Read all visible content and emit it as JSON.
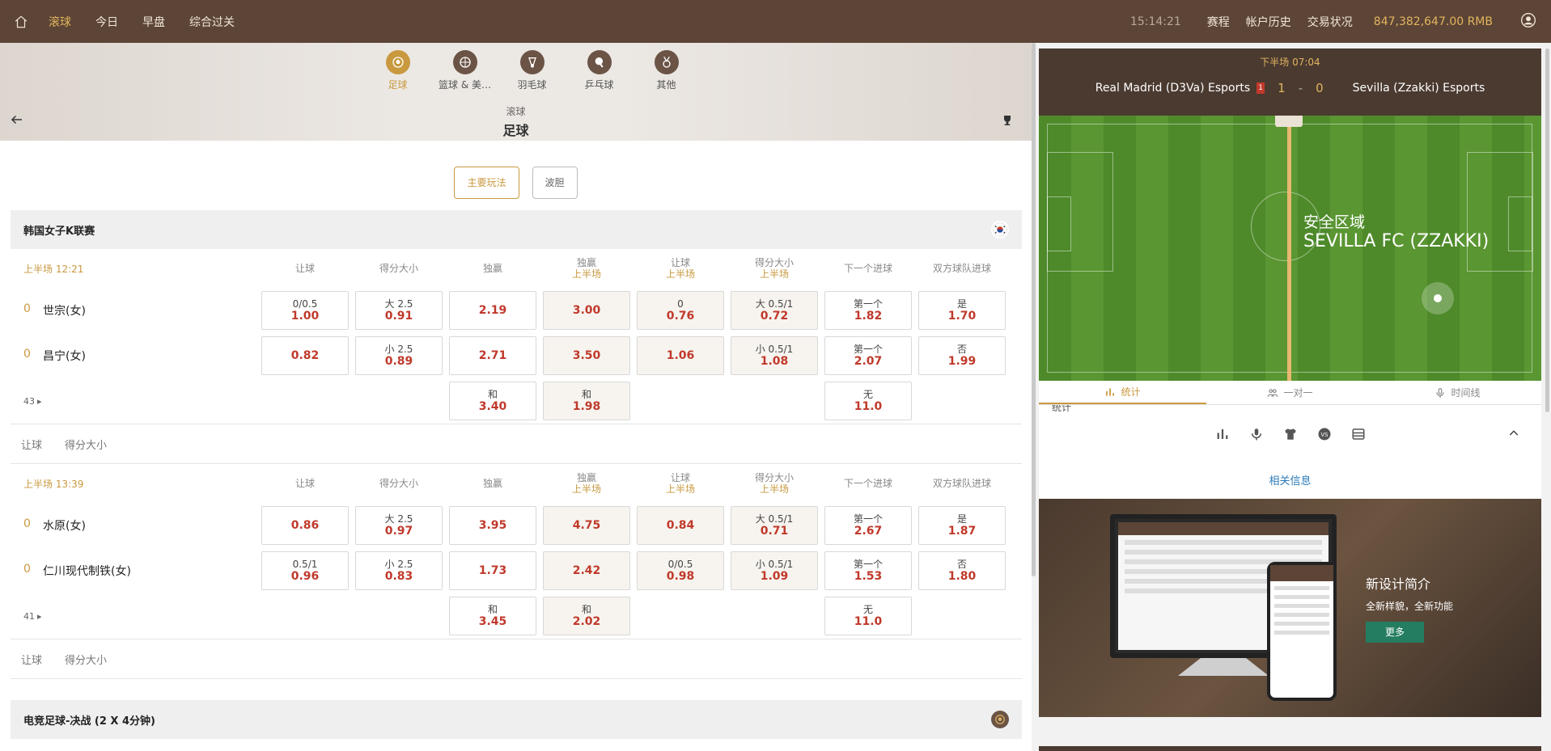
{
  "topbar": {
    "nav": [
      "滚球",
      "今日",
      "早盘",
      "综合过关"
    ],
    "time": "15:14:21",
    "links": [
      "赛程",
      "帐户历史",
      "交易状况"
    ],
    "balance": "847,382,647.00 RMB",
    "accent": "#e2b45f"
  },
  "sports": [
    "足球",
    "篮球 & 美…",
    "羽毛球",
    "乒乓球",
    "其他"
  ],
  "crumb": {
    "parent": "滚球",
    "current": "足球"
  },
  "tabs": [
    "主要玩法",
    "波胆"
  ],
  "leagues": [
    {
      "name": "韩国女子K联赛",
      "match": {
        "clock": "上半场  12:21",
        "headers": [
          {
            "t": "让球",
            "s": ""
          },
          {
            "t": "得分大小",
            "s": ""
          },
          {
            "t": "独赢",
            "s": ""
          },
          {
            "t": "独赢",
            "s": "上半场"
          },
          {
            "t": "让球",
            "s": "上半场"
          },
          {
            "t": "得分大小",
            "s": "上半场"
          },
          {
            "t": "下一个进球",
            "s": ""
          },
          {
            "t": "双方球队进球",
            "s": ""
          }
        ],
        "teams": [
          {
            "score": "0",
            "name": "世宗(女)",
            "odds": [
              {
                "t": "0/0.5",
                "o": "1.00"
              },
              {
                "t": "大 2.5",
                "o": "0.91"
              },
              {
                "t": "",
                "o": "2.19"
              },
              {
                "t": "",
                "o": "3.00"
              },
              {
                "t": "0",
                "o": "0.76"
              },
              {
                "t": "大 0.5/1",
                "o": "0.72"
              },
              {
                "t": "第一个",
                "o": "1.82"
              },
              {
                "t": "是",
                "o": "1.70"
              }
            ]
          },
          {
            "score": "0",
            "name": "昌宁(女)",
            "odds": [
              {
                "t": "",
                "o": "0.82"
              },
              {
                "t": "小 2.5",
                "o": "0.89"
              },
              {
                "t": "",
                "o": "2.71"
              },
              {
                "t": "",
                "o": "3.50"
              },
              {
                "t": "",
                "o": "1.06"
              },
              {
                "t": "小 0.5/1",
                "o": "1.08"
              },
              {
                "t": "第一个",
                "o": "2.07"
              },
              {
                "t": "否",
                "o": "1.99"
              }
            ]
          }
        ],
        "more": "43",
        "draw": [
          {
            "t": "和",
            "o": "3.40"
          },
          {
            "t": "和",
            "o": "1.98"
          },
          {
            "t": "无",
            "o": "11.0"
          }
        ],
        "footer": [
          "让球",
          "得分大小"
        ]
      }
    },
    {
      "name": "",
      "match": {
        "clock": "上半场  13:39",
        "teams": [
          {
            "score": "0",
            "name": "水原(女)",
            "odds": [
              {
                "t": "",
                "o": "0.86"
              },
              {
                "t": "大 2.5",
                "o": "0.97"
              },
              {
                "t": "",
                "o": "3.95"
              },
              {
                "t": "",
                "o": "4.75"
              },
              {
                "t": "",
                "o": "0.84"
              },
              {
                "t": "大 0.5/1",
                "o": "0.71"
              },
              {
                "t": "第一个",
                "o": "2.67"
              },
              {
                "t": "是",
                "o": "1.87"
              }
            ]
          },
          {
            "score": "0",
            "name": "仁川现代制铁(女)",
            "odds": [
              {
                "t": "0.5/1",
                "o": "0.96"
              },
              {
                "t": "小 2.5",
                "o": "0.83"
              },
              {
                "t": "",
                "o": "1.73"
              },
              {
                "t": "",
                "o": "2.42"
              },
              {
                "t": "0/0.5",
                "o": "0.98"
              },
              {
                "t": "小 0.5/1",
                "o": "1.09"
              },
              {
                "t": "第一个",
                "o": "1.53"
              },
              {
                "t": "否",
                "o": "1.80"
              }
            ]
          }
        ],
        "more": "41",
        "draw": [
          {
            "t": "和",
            "o": "3.45"
          },
          {
            "t": "和",
            "o": "2.02"
          },
          {
            "t": "无",
            "o": "11.0"
          }
        ],
        "footer": [
          "让球",
          "得分大小"
        ]
      }
    }
  ],
  "league3": "电竞足球-决战 (2 X 4分钟)",
  "scoreboard": {
    "period": "下半场  07:04",
    "home": "Real Madrid (D3Va) Esports",
    "red_cards": "1",
    "home_score": "1",
    "sep": "-",
    "away_score": "0",
    "away": "Sevilla (Zzakki) Esports"
  },
  "pitch": {
    "zone": "安全区域",
    "team": "SEVILLA FC (ZZAKKI)"
  },
  "rtabs": [
    "统计",
    "一对一",
    "时间线"
  ],
  "rstat_cut": "统计",
  "related": "相关信息",
  "promo": {
    "title": "新设计简介",
    "subtitle": "全新样貌，全新功能",
    "button": "更多"
  }
}
